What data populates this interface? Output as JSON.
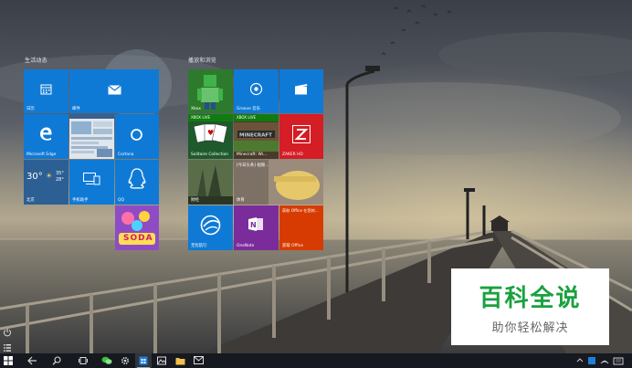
{
  "groups": {
    "life": "生活动态",
    "entertainment": "播放和浏览"
  },
  "tiles": {
    "calendar": "日历",
    "mail": "邮件",
    "edge": "Microsoft Edge",
    "photos": "",
    "cortana": "Cortana",
    "weather_temp": "30°",
    "weather_hi": "35°",
    "weather_lo": "28°",
    "weather_city": "北京",
    "phone": "手机助手",
    "qq": "QQ",
    "candy": "SODA",
    "xbox": "Xbox",
    "groove": "Groove 音乐",
    "movies": "",
    "xbox_live": "XBOX LIVE",
    "solitaire": "Solitaire Collection",
    "minecraft": "Minecraft: Wi...",
    "zaker": "ZAKER HD",
    "news_headline": "[今日头条] 视频…",
    "news": "财经",
    "sports": "体育",
    "flight": "无忧航行",
    "onenote": "OneNote",
    "office_promo": "获取 Office 在您的…",
    "office": "获取 Office"
  },
  "watermark": {
    "title": "百科全说",
    "subtitle": "助你轻松解决"
  },
  "taskbar": {
    "items": [
      "start-icon",
      "back-icon",
      "search-icon",
      "task-view-icon",
      "wechat-icon",
      "settings-icon",
      "store-icon",
      "photos-icon",
      "explorer-icon",
      "mail-icon"
    ]
  },
  "colors": {
    "tile_blue": "#0f7ad6",
    "xbox_green": "#107c10",
    "zaker_red": "#d41d24",
    "onenote_purple": "#7a2c9b",
    "office_red": "#d83b01",
    "watermark_green": "#1aa13e"
  }
}
